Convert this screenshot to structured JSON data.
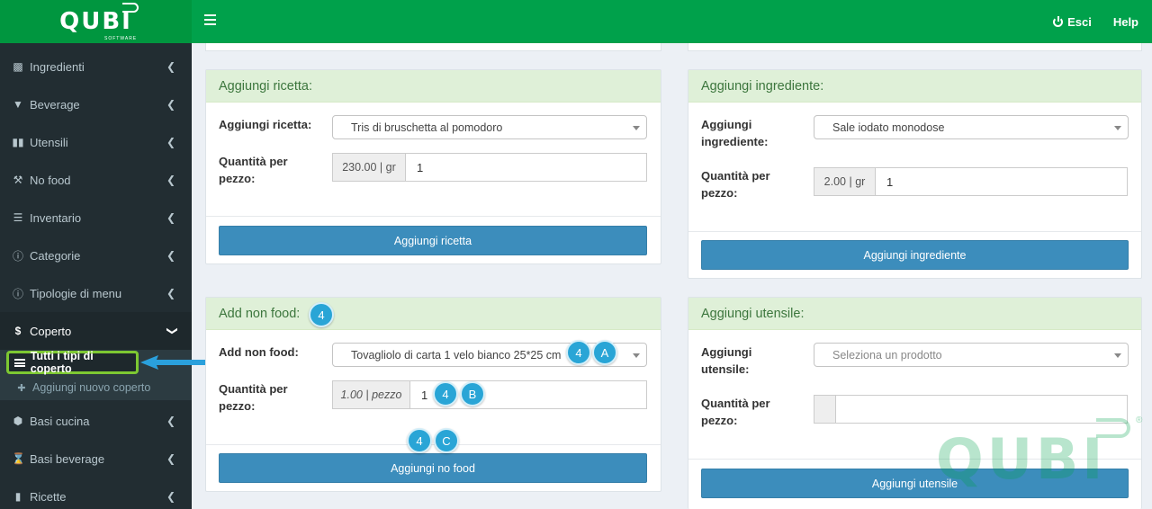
{
  "app": {
    "logo": "QUBI",
    "logo_sub": "SOFTWARE"
  },
  "header": {
    "logout_label": "Esci",
    "help_label": "Help"
  },
  "sidebar": {
    "items": [
      {
        "label": "Ingredienti",
        "icon": "sitemap-icon"
      },
      {
        "label": "Beverage",
        "icon": "glass-icon"
      },
      {
        "label": "Utensili",
        "icon": "cutlery-icon"
      },
      {
        "label": "No food",
        "icon": "wrench-icon"
      },
      {
        "label": "Inventario",
        "icon": "list-icon"
      },
      {
        "label": "Categorie",
        "icon": "info-icon"
      },
      {
        "label": "Tipologie di menu",
        "icon": "info-icon"
      },
      {
        "label": "Coperto",
        "icon": "dollar-icon"
      },
      {
        "label": "Basi cucina",
        "icon": "cube-icon"
      },
      {
        "label": "Basi beverage",
        "icon": "hourglass-icon"
      },
      {
        "label": "Ricette",
        "icon": "file-icon"
      }
    ],
    "submenu": [
      {
        "label": "Tutti i tipi di coperto",
        "icon": "list-icon"
      },
      {
        "label": "Aggiungi nuovo coperto",
        "icon": "plus-circle-icon"
      }
    ]
  },
  "recipe": {
    "title": "Aggiungi ricetta:",
    "select_label": "Aggiungi ricetta:",
    "select_value": "Tris di bruschetta al pomodoro",
    "qty_label": "Quantità per pezzo:",
    "qty_unit": "230.00 | gr",
    "qty_value": "1",
    "button": "Aggiungi ricetta"
  },
  "ingredient": {
    "title": "Aggiungi ingrediente:",
    "select_label": "Aggiungi ingrediente:",
    "select_value": "Sale iodato monodose",
    "qty_label": "Quantità per pezzo:",
    "qty_unit": "2.00 | gr",
    "qty_value": "1",
    "button": "Aggiungi ingrediente"
  },
  "nonfood": {
    "title": "Add non food:",
    "select_label": "Add non food:",
    "select_value": "Tovagliolo di carta 1 velo bianco 25*25 cm",
    "qty_label": "Quantità per pezzo:",
    "qty_unit": "1.00 | pezzo",
    "qty_value": "1",
    "button": "Aggiungi no food"
  },
  "utensil": {
    "title": "Aggiungi utensile:",
    "select_label": "Aggiungi utensile:",
    "select_placeholder": "Seleziona un prodotto",
    "qty_label": "Quantità per pezzo:",
    "qty_unit": "",
    "qty_value": "",
    "button": "Aggiungi utensile"
  },
  "badges": {
    "title": "4",
    "select_num": "4",
    "select_letter": "A",
    "qty_num": "4",
    "qty_letter": "B",
    "btn_num": "4",
    "btn_letter": "C"
  },
  "watermark": {
    "text": "QUBI",
    "reg": "®"
  },
  "colors": {
    "header": "#00a14b",
    "sidebar": "#222d32",
    "button": "#3c8dbc",
    "panel_head": "#dff0d8",
    "badge": "#29a5d6",
    "highlight": "#7dc832"
  }
}
